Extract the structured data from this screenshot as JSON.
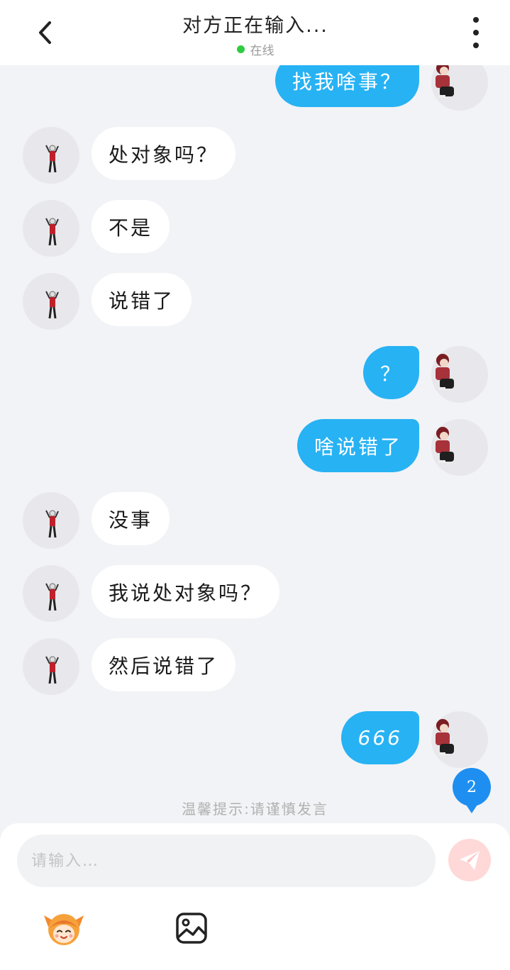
{
  "header": {
    "title": "对方正在输入...",
    "status": "在线",
    "status_color": "#2ecc40"
  },
  "messages": [
    {
      "direction": "out",
      "text": "找我啥事？"
    },
    {
      "direction": "in",
      "text": "处对象吗？"
    },
    {
      "direction": "in",
      "text": "不是"
    },
    {
      "direction": "in",
      "text": "说错了"
    },
    {
      "direction": "out",
      "text": "？"
    },
    {
      "direction": "out",
      "text": "啥说错了"
    },
    {
      "direction": "in",
      "text": "没事"
    },
    {
      "direction": "in",
      "text": "我说处对象吗？"
    },
    {
      "direction": "in",
      "text": "然后说错了"
    },
    {
      "direction": "out",
      "text": "666"
    }
  ],
  "tip": "温馨提示:请谨慎发言",
  "unread_badge": "2",
  "composer": {
    "placeholder": "请输入…",
    "send_icon": "paper-plane-icon",
    "tools": [
      {
        "icon": "sticker-face-icon"
      },
      {
        "icon": "image-icon"
      }
    ]
  },
  "colors": {
    "outgoing_bubble": "#27b2f4",
    "incoming_bubble": "#ffffff",
    "background": "#f2f3f6",
    "badge": "#1e8ff0"
  }
}
